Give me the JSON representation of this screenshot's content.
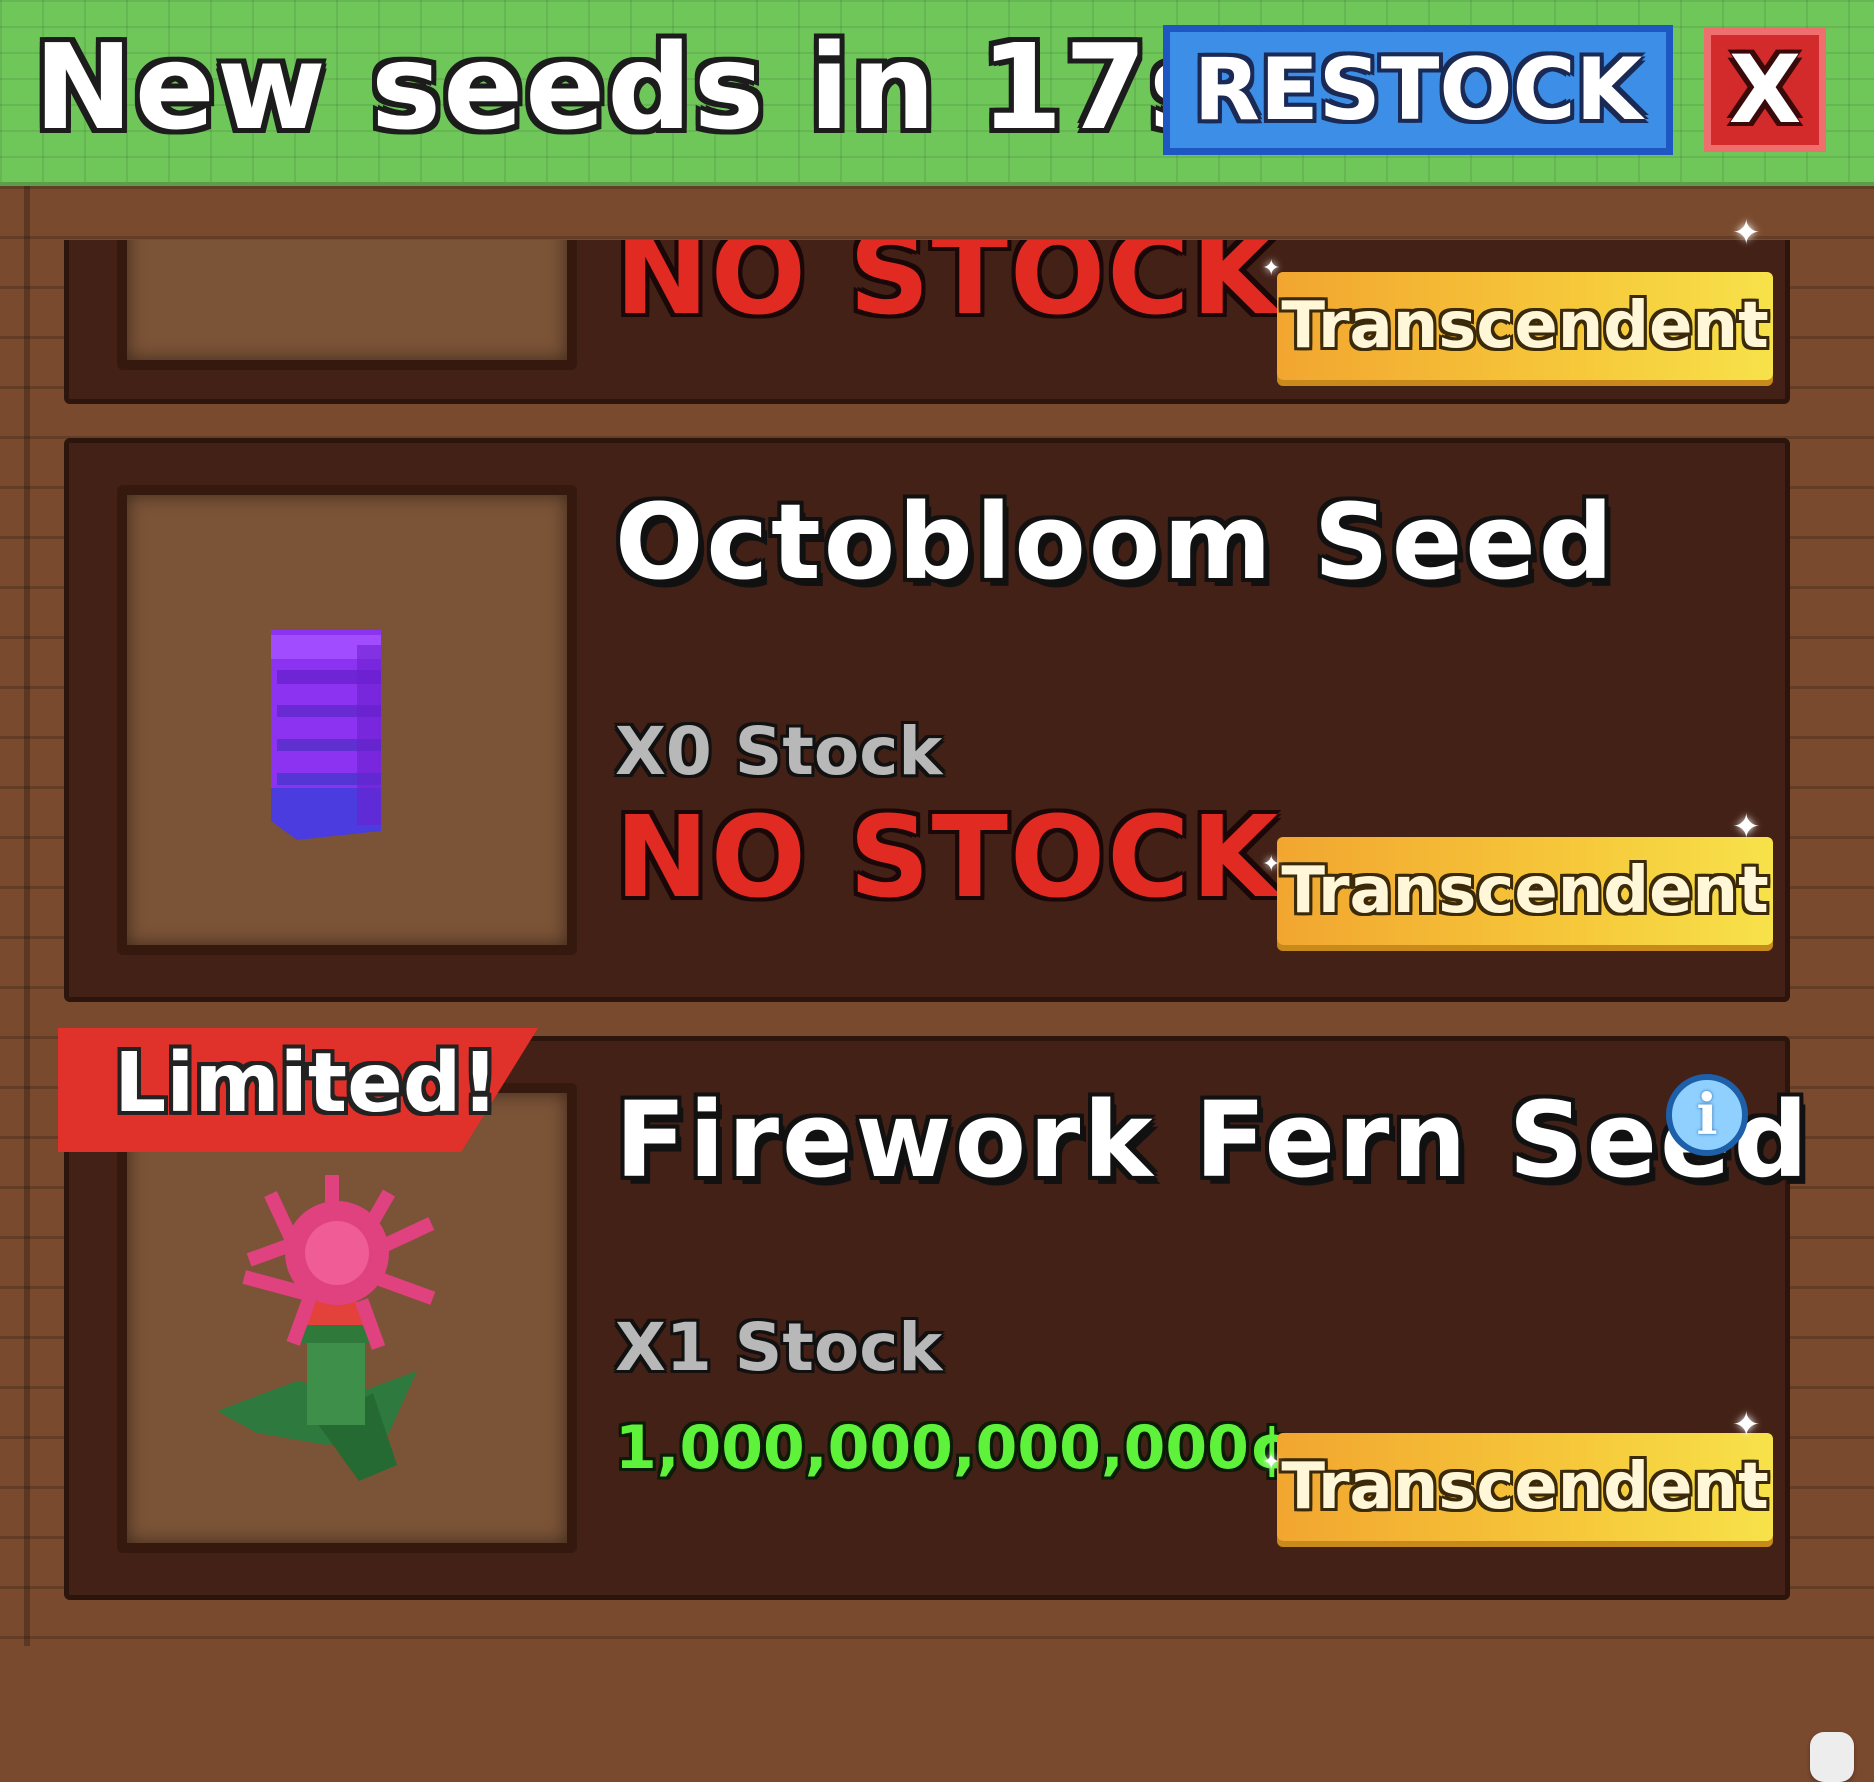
{
  "header": {
    "title": "New seeds in 17s",
    "restock_label": "RESTOCK",
    "close_label": "X"
  },
  "items": [
    {
      "name": "",
      "stock_status": "NO STOCK",
      "rarity": "Transcendent"
    },
    {
      "name": "Octobloom Seed",
      "stock_count": "X0 Stock",
      "stock_status": "NO STOCK",
      "rarity": "Transcendent",
      "icon": "purple-block-seed-icon"
    },
    {
      "badge": "Limited!",
      "name": "Firework Fern Seed",
      "stock_count": "X1 Stock",
      "price": "1,000,000,000,000¢",
      "rarity": "Transcendent",
      "icon": "pink-firework-fern-icon",
      "info_icon": "i"
    }
  ],
  "colors": {
    "header_green": "#6fc75a",
    "restock_blue": "#3d8ee6",
    "close_red": "#d32b2b",
    "card_brown": "#432116",
    "no_stock_red": "#e02a22",
    "price_green": "#5ef33a",
    "rarity_gold": "#f6c83a"
  }
}
